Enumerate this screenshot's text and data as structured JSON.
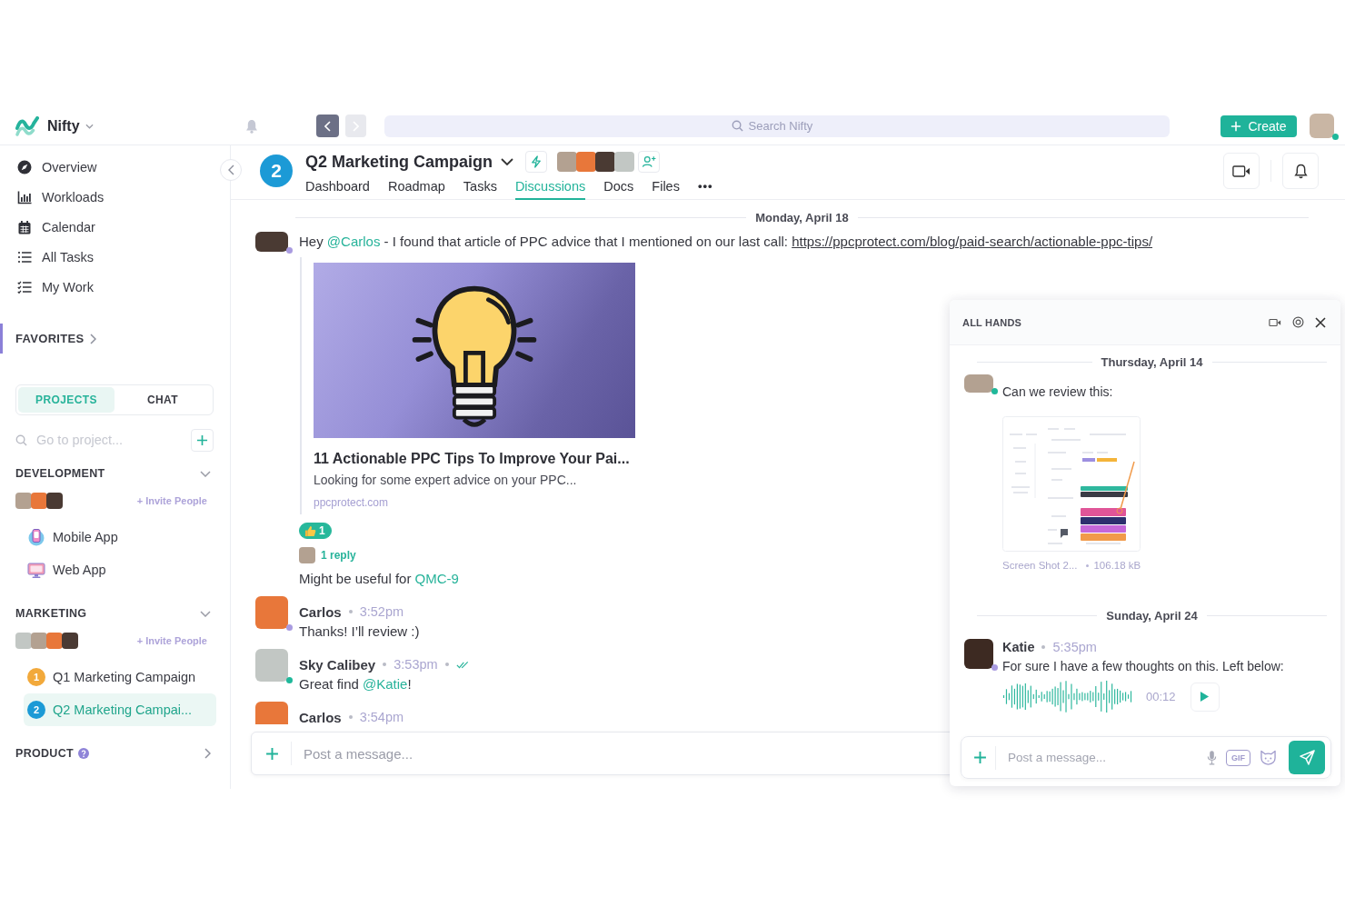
{
  "topbar": {
    "brand": "Nifty",
    "navigation": {
      "back": {
        "disabled": false
      },
      "forward": {
        "disabled": true
      }
    },
    "search": {
      "placeholder": "Search Nifty"
    },
    "create_label": "Create",
    "user": {
      "color": "#c9b6a4",
      "status": {
        "color": "#1fb89a"
      }
    }
  },
  "sidebar": {
    "nav": [
      "Overview",
      "Workloads",
      "Calendar",
      "All Tasks",
      "My Work"
    ],
    "favorites": {
      "label": "FAVORITES",
      "expanded": false,
      "highlighted": true
    },
    "tabs": [
      {
        "label": "PROJECTS",
        "selected": true
      },
      {
        "label": "CHAT",
        "selected": false
      }
    ],
    "project_search": {
      "placeholder": "Go to project..."
    },
    "groups": [
      {
        "name": "DEVELOPMENT",
        "expanded": true,
        "avatars": [
          {
            "color": "#b3a191"
          },
          {
            "color": "#e8773a"
          },
          {
            "color": "#4a3a33"
          }
        ],
        "invite": "+ Invite People",
        "projects": [
          {
            "name": "Mobile App",
            "kind": "app-mobile",
            "selected": false
          },
          {
            "name": "Web App",
            "kind": "app-web",
            "selected": false
          }
        ]
      },
      {
        "name": "MARKETING",
        "expanded": true,
        "avatars": [
          {
            "color": "#c2c7c4"
          },
          {
            "color": "#b3a191"
          },
          {
            "color": "#e8773a"
          },
          {
            "color": "#4a3a33"
          }
        ],
        "invite": "+ Invite People",
        "projects": [
          {
            "name": "Q1 Marketing Campaign",
            "kind": "numbered",
            "badge": "1",
            "color": "#f2a93b",
            "selected": false
          },
          {
            "name": "Q2 Marketing Campai...",
            "kind": "numbered",
            "badge": "2",
            "color": "#1c9ad6",
            "selected": true
          }
        ]
      },
      {
        "name": "PRODUCT",
        "expanded": false,
        "help": true
      }
    ]
  },
  "project": {
    "badge": "2",
    "color": "#1c9ad6",
    "title": "Q2 Marketing Campaign",
    "avatars": [
      {
        "color": "#b3a191"
      },
      {
        "color": "#e8773a"
      },
      {
        "color": "#4a3a33"
      },
      {
        "color": "#c2c7c4"
      }
    ],
    "tabs": [
      {
        "label": "Dashboard",
        "selected": false
      },
      {
        "label": "Roadmap",
        "selected": false
      },
      {
        "label": "Tasks",
        "selected": false
      },
      {
        "label": "Discussions",
        "selected": true
      },
      {
        "label": "Docs",
        "selected": false
      },
      {
        "label": "Files",
        "selected": false
      }
    ],
    "more": "•••"
  },
  "discussion": {
    "date": "Monday, April 18",
    "messages": [
      {
        "kind": "post",
        "avatar": {
          "color": "#4a3a33"
        },
        "status": {
          "color": "#a99be0"
        },
        "text": [
          {
            "text": "Hey "
          },
          {
            "text": "@Carlos",
            "kind": "mention"
          },
          {
            "text": " - I found that article of PPC advice that I mentioned on our last call: "
          },
          {
            "text": "https://ppcprotect.com/blog/paid-search/actionable-ppc-tips/",
            "kind": "link"
          }
        ],
        "preview": {
          "title": "11 Actionable PPC Tips To Improve Your Pai...",
          "description": "Looking for some expert advice on your PPC...",
          "domain": "ppcprotect.com"
        },
        "reaction": {
          "count": "1",
          "selected": true
        },
        "replies": {
          "label": "1 reply",
          "avatar": {
            "color": "#b3a191"
          }
        },
        "followup": [
          {
            "text": "Might be useful for "
          },
          {
            "text": "QMC-9",
            "kind": "mention"
          }
        ]
      },
      {
        "kind": "message",
        "author": "Carlos",
        "time": "3:52pm",
        "read": false,
        "avatar": {
          "color": "#e8773a"
        },
        "status": {
          "color": "#a99be0"
        },
        "text": [
          {
            "text": "Thanks! I’ll review :)"
          }
        ]
      },
      {
        "kind": "message",
        "author": "Sky Calibey",
        "time": "3:53pm",
        "read": true,
        "avatar": {
          "color": "#c2c7c4"
        },
        "status": {
          "color": "#1fb89a"
        },
        "text": [
          {
            "text": "Great find "
          },
          {
            "text": "@Katie",
            "kind": "mention"
          },
          {
            "text": "!"
          }
        ]
      },
      {
        "kind": "message",
        "author": "Carlos",
        "time": "3:54pm",
        "read": false,
        "avatar": {
          "color": "#e8773a"
        }
      }
    ],
    "composer": {
      "placeholder": "Post a message..."
    }
  },
  "chat_panel": {
    "title": "ALL HANDS",
    "items": [
      {
        "kind": "date",
        "label": "Thursday, April 14"
      },
      {
        "kind": "message",
        "avatar": {
          "color": "#b3a191"
        },
        "status": {
          "color": "#1fb89a"
        },
        "text": "Can we review this:",
        "attachment": {
          "name": "Screen Shot 2...",
          "size": "106.18 kB"
        }
      },
      {
        "kind": "date",
        "label": "Sunday, April 24"
      },
      {
        "kind": "message",
        "author": "Katie",
        "time": "5:35pm",
        "avatar": {
          "color": "#3d2a22"
        },
        "status": {
          "color": "#a99be0"
        },
        "text": "For sure I have a few thoughts on this. Left below:",
        "voice": {
          "duration": "00:12"
        }
      }
    ],
    "composer": {
      "placeholder": "Post a message...",
      "gif": "GIF"
    }
  }
}
